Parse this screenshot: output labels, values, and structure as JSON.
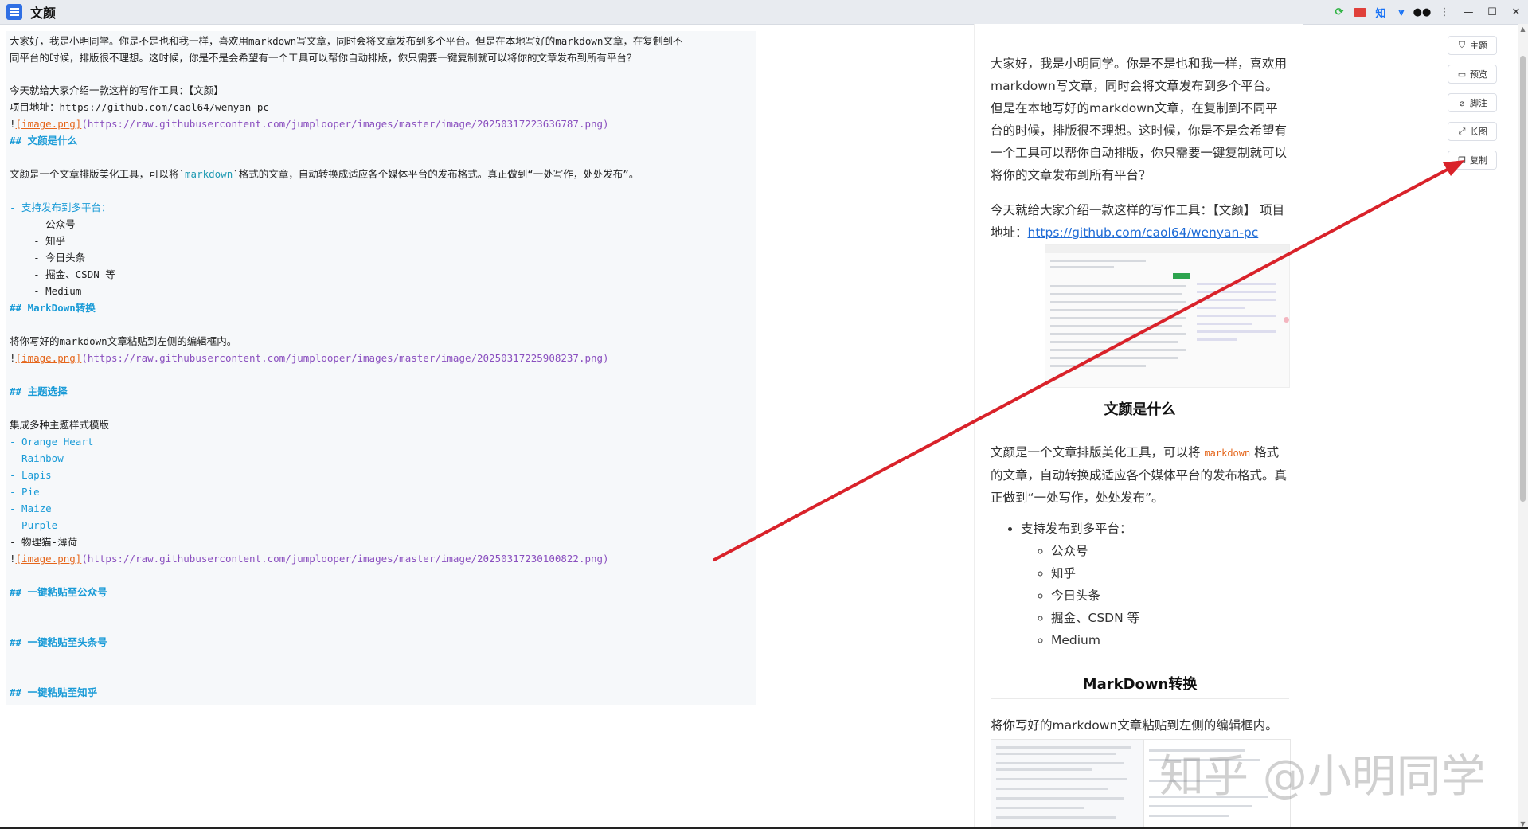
{
  "window": {
    "title": "文颜",
    "tray_icons": [
      "refresh-icon",
      "badge-icon",
      "zhihu-icon",
      "download-icon",
      "medium-icon"
    ],
    "tray_zhihu": "知",
    "controls": [
      "⋮",
      "—",
      "☐",
      "✕"
    ]
  },
  "editor": {
    "lines": [
      "大家好，我是小明同学。你是不是也和我一样，喜欢用markdown写文章，同时会将文章发布到多个平台。但是在本地写好的markdown文章，在复制到不",
      "同平台的时候，排版很不理想。这时候，你是不是会希望有一个工具可以帮你自动排版，你只需要一键复制就可以将你的文章发布到所有平台？",
      "今天就给大家介绍一款这样的写作工具：【文颜】",
      "项目地址：https://github.com/caol64/wenyan-pc",
      "[image.png]",
      "(https://raw.githubusercontent.com/jumplooper/images/master/image/20250317223636787.png)",
      "## 文颜是什么",
      "文颜是一个文章排版美化工具，可以将`",
      "markdown",
      "`格式的文章，自动转换成适应各个媒体平台的发布格式。真正做到“一处写作，处处发布”。",
      "- 支持发布到多平台：",
      "    - 公众号",
      "    - 知乎",
      "    - 今日头条",
      "    - 掘金、CSDN 等",
      "    - Medium",
      "## MarkDown转换",
      "将你写好的markdown文章粘贴到左侧的编辑框内。",
      "[image.png]",
      "(https://raw.githubusercontent.com/jumplooper/images/master/image/20250317225908237.png)",
      "## 主题选择",
      "集成多种主题样式模版",
      "- Orange Heart",
      "- Rainbow",
      "- Lapis",
      "- Pie",
      "- Maize",
      "- Purple",
      "- 物理猫-薄荷",
      "[image.png]",
      "(https://raw.githubusercontent.com/jumplooper/images/master/image/20250317230100822.png)",
      "## 一键粘贴至公众号",
      "## 一键粘贴至头条号",
      "## 一键粘贴至知乎"
    ],
    "bang": "!"
  },
  "preview": {
    "intro": "大家好，我是小明同学。你是不是也和我一样，喜欢用markdown写文章，同时会将文章发布到多个平台。但是在本地写好的markdown文章，在复制到不同平台的时候，排版很不理想。这时候，你是不是会希望有一个工具可以帮你自动排版，你只需要一键复制就可以将你的文章发布到所有平台？",
    "tool_intro": "今天就给大家介绍一款这样的写作工具：【文颜】 项目地址：",
    "project_link": "https://github.com/caol64/wenyan-pc",
    "h_what": "文颜是什么",
    "what_a": "文颜是一个文章排版美化工具，可以将 ",
    "what_code": "markdown",
    "what_b": " 格式的文章，自动转换成适应各个媒体平台的发布格式。真正做到“一处写作，处处发布”。",
    "platforms_title": "支持发布到多平台：",
    "platforms": [
      "公众号",
      "知乎",
      "今日头条",
      "掘金、CSDN 等",
      "Medium"
    ],
    "h_convert": "MarkDown转换",
    "convert_text": "将你写好的markdown文章粘贴到左侧的编辑框内。"
  },
  "toolbar": {
    "theme": "主题",
    "preview": "预览",
    "footnote": "脚注",
    "longimage": "长图",
    "copy": "复制"
  },
  "watermark": "知乎 @小明同学",
  "colors": {
    "heading": "#1a9bd7",
    "link_text": "#e5661b",
    "url": "#8a4fbf",
    "arrow": "#d9222a"
  }
}
